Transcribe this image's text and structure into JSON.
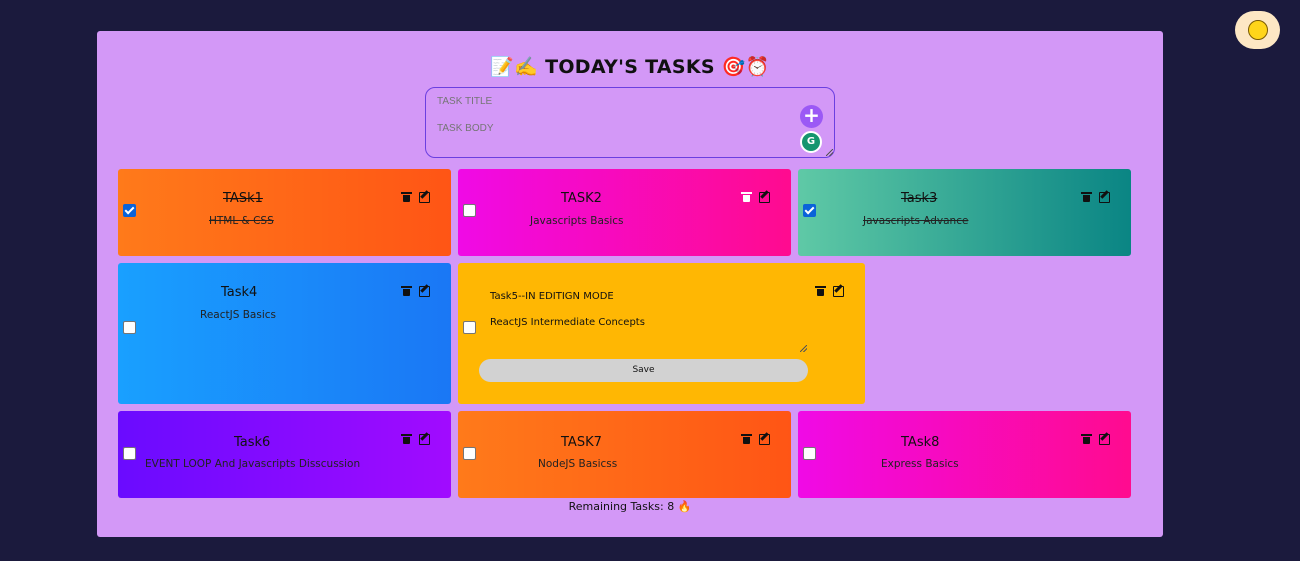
{
  "header": {
    "title": "📝✍️ TODAY'S TASKS 🎯⏰"
  },
  "new_task": {
    "title_placeholder": "TASK TITLE",
    "body_placeholder": "TASK BODY",
    "add_label": "+",
    "grammar_label": "G"
  },
  "tasks": [
    {
      "title": "TASk1",
      "body": "HTML & CSS",
      "completed": true
    },
    {
      "title": "TASK2",
      "body": "Javascripts Basics",
      "completed": false
    },
    {
      "title": "Task3",
      "body": "Javascripts Advance",
      "completed": true
    },
    {
      "title": "Task4",
      "body": "ReactJS Basics",
      "completed": false
    },
    {
      "title": "Task5--IN EDITIGN MODE",
      "body": "ReactJS Intermediate Concepts",
      "completed": false,
      "editing": true
    },
    {
      "title": "Task6",
      "body": "EVENT LOOP And Javascripts Disscussion",
      "completed": false
    },
    {
      "title": "TASK7",
      "body": "NodeJS Basicss",
      "completed": false
    },
    {
      "title": "TAsk8",
      "body": "Express Basics",
      "completed": false
    }
  ],
  "edit": {
    "save_label": "Save"
  },
  "footer": {
    "remaining_text": "Remaining Tasks: 8 🔥"
  },
  "colors": {
    "background": "#1b1a3d",
    "panel": "#d398f7",
    "accent": "#9b59f5"
  }
}
